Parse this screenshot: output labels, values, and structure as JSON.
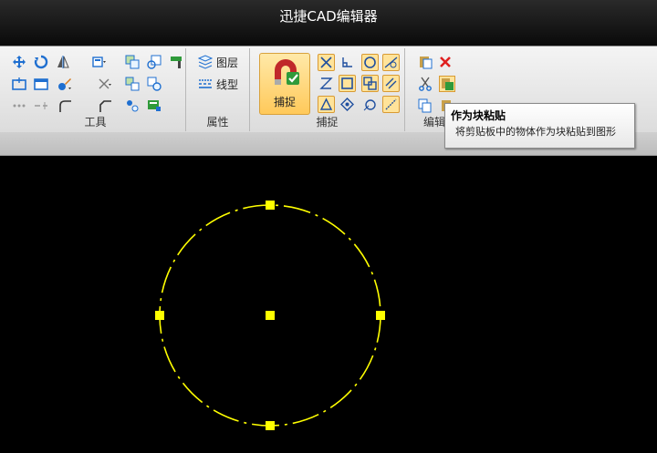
{
  "window": {
    "title": "迅捷CAD编辑器"
  },
  "ribbon": {
    "groups": {
      "tools": {
        "label": "工具"
      },
      "properties": {
        "label": "属性",
        "layer_label": "图层",
        "linetype_label": "线型"
      },
      "snap": {
        "label": "捕捉",
        "snap_button_label": "捕捉"
      },
      "edit": {
        "label": "编辑"
      }
    }
  },
  "tooltip": {
    "title": "作为块粘贴",
    "description": "将剪贴板中的物体作为块粘贴到图形"
  },
  "colors": {
    "drawing": "#ffff00",
    "canvas_background": "#000000",
    "delete_icon": "#e02020",
    "icon_blue": "#1f6fd0"
  },
  "drawing": {
    "shape": "circle",
    "grips": [
      "center",
      "top",
      "right",
      "bottom",
      "left"
    ]
  }
}
